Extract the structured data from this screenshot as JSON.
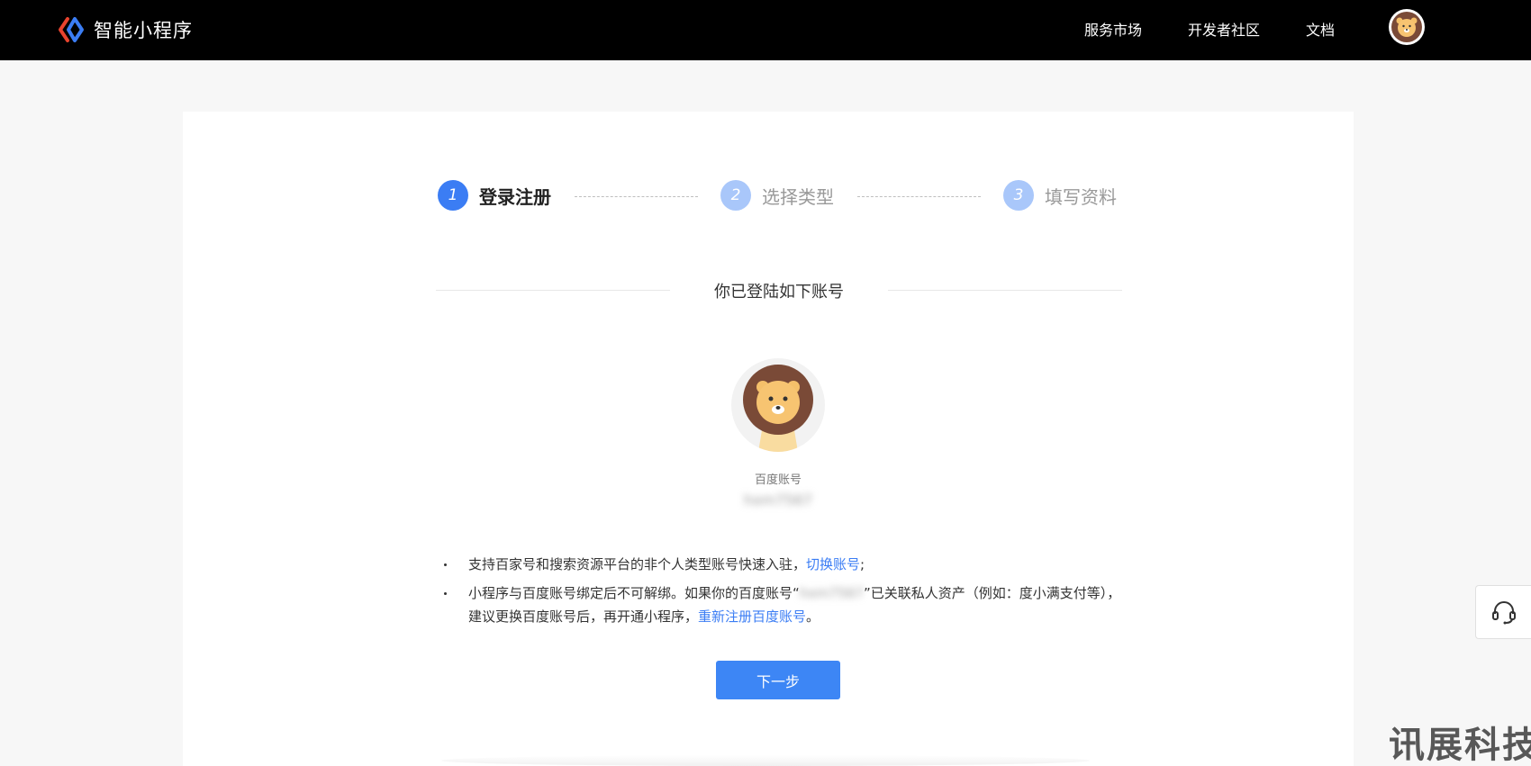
{
  "header": {
    "brand": "智能小程序",
    "nav": [
      "服务市场",
      "开发者社区",
      "文档"
    ],
    "avatar_icon": "lion-avatar-icon"
  },
  "steps": [
    {
      "num": "1",
      "label": "登录注册",
      "state": "active"
    },
    {
      "num": "2",
      "label": "选择类型",
      "state": "inactive"
    },
    {
      "num": "3",
      "label": "填写资料",
      "state": "inactive"
    }
  ],
  "account": {
    "section_title": "你已登陆如下账号",
    "label": "百度账号",
    "value": "hxm7567"
  },
  "notes": {
    "note1_text": "支持百家号和搜索资源平台的非个人类型账号快速入驻，",
    "note1_link": "切换账号",
    "note1_end": ";",
    "note2_text_a": "小程序与百度账号绑定后不可解绑。如果你的百度账号“",
    "note2_blur": "hxm7567",
    "note2_text_b": "”已关联私人资产（例如：度小满支付等），建议更换百度账号后，再开通小程序，",
    "note2_link": "重新注册百度账号",
    "note2_end": "。"
  },
  "actions": {
    "next_label": "下一步"
  },
  "watermark": "讯展科技",
  "colors": {
    "primary": "#3b7df4",
    "step_inactive": "#a9c7fa",
    "topbar": "#000000"
  }
}
